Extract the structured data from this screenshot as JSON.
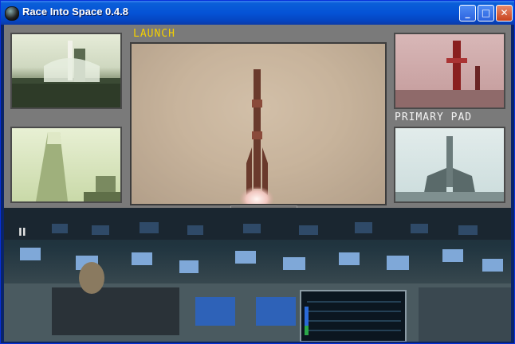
{
  "window": {
    "title": "Race Into Space 0.4.8",
    "controls": {
      "minimize": "_",
      "maximize": "□",
      "close": "✕"
    }
  },
  "labels": {
    "launch": "LAUNCH",
    "primary_pad": "PRIMARY PAD"
  },
  "control_panel": {
    "buttons": [
      "rewind-icon",
      "play-icon",
      "forward-icon",
      "stop-icon"
    ]
  },
  "mission_control": {
    "pause_indicator": "II"
  },
  "colors": {
    "label_yellow": "#f4d000",
    "label_white": "#f2f2f2",
    "panel_gray": "#7a7a7a"
  }
}
